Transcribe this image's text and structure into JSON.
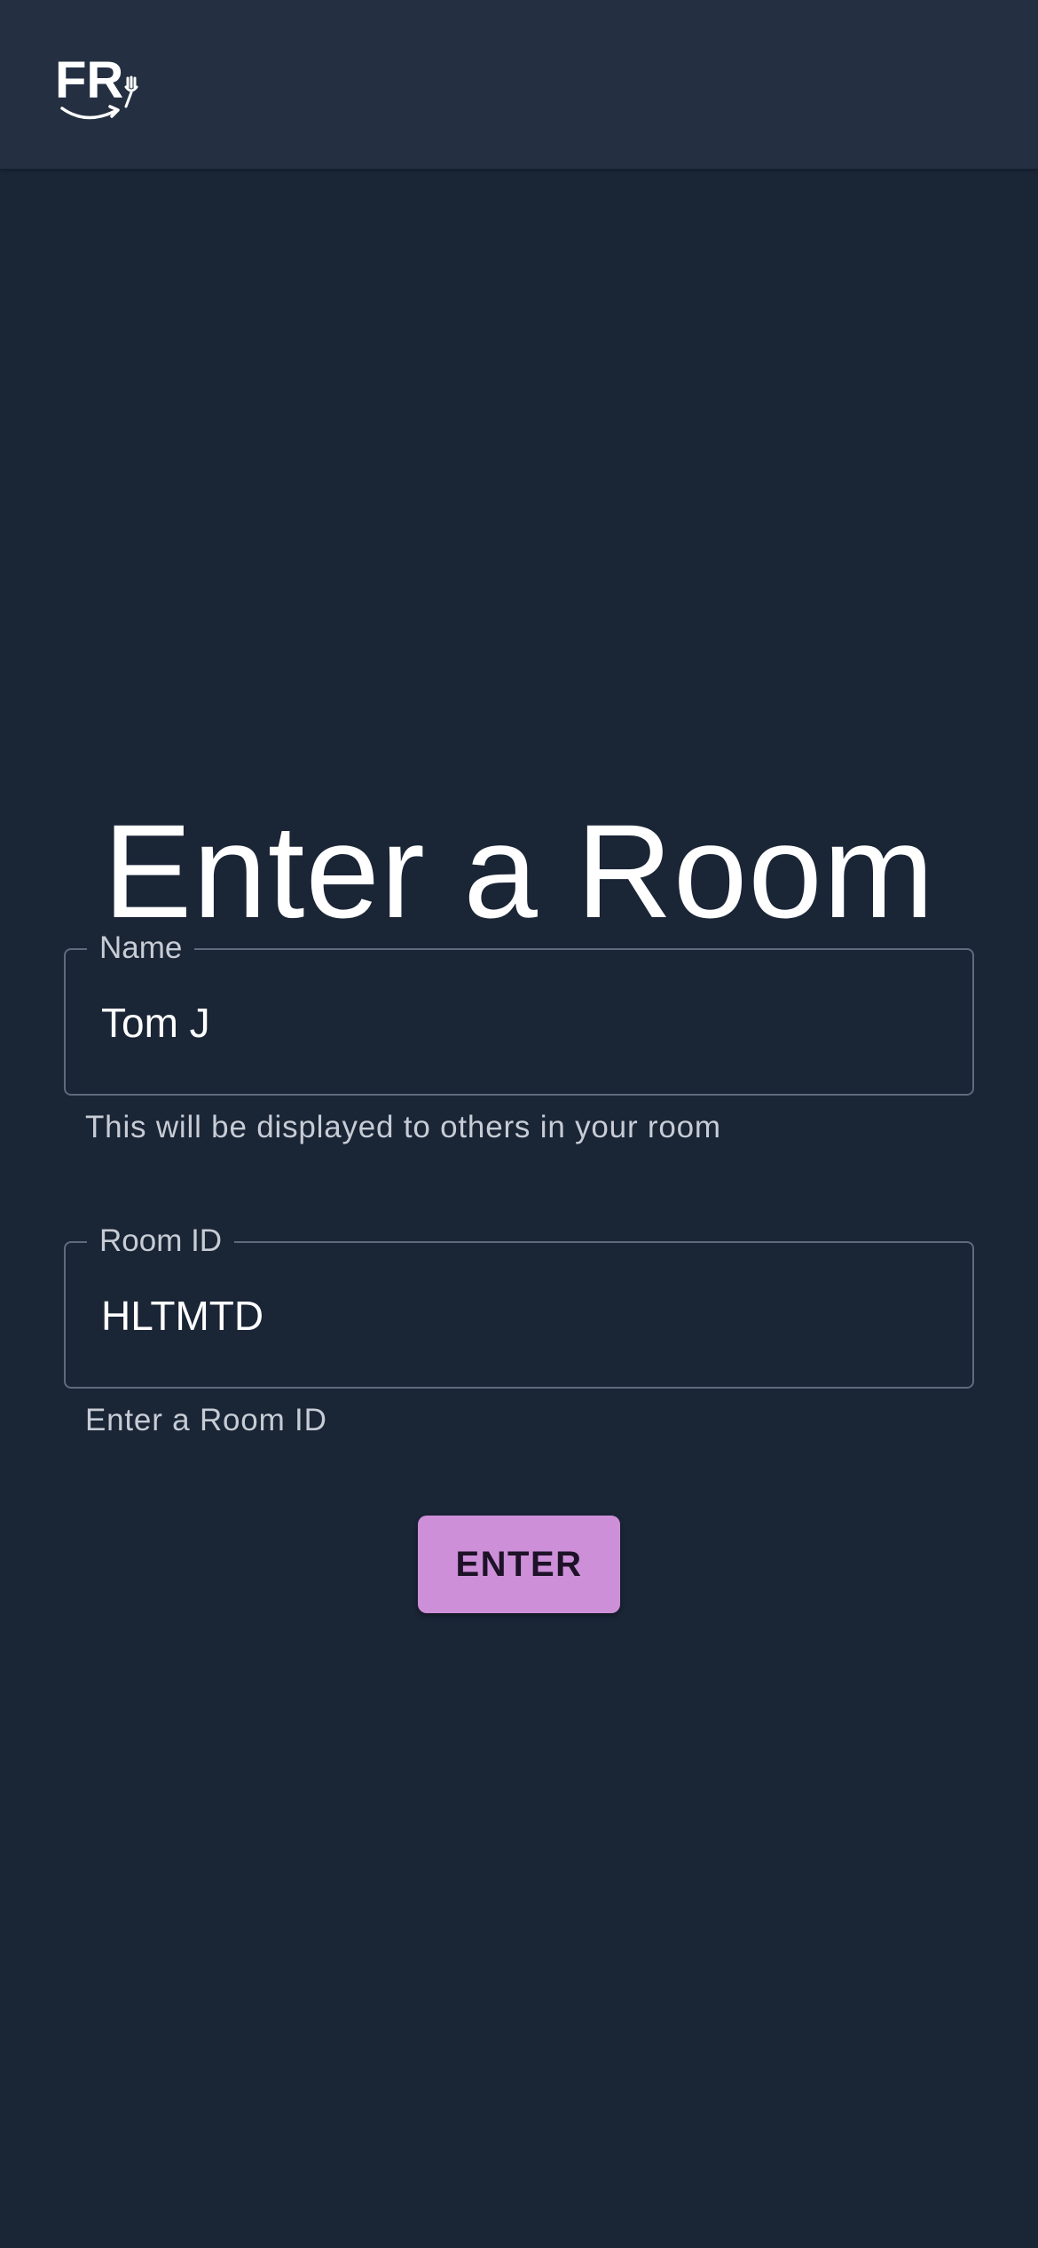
{
  "header": {
    "logo_text": "FR",
    "logo_icon": "fork-smile-logo"
  },
  "main": {
    "title": "Enter a Room"
  },
  "form": {
    "name": {
      "label": "Name",
      "value": "Tom J",
      "helper": "This will be displayed to others in your room"
    },
    "room_id": {
      "label": "Room ID",
      "value": "HLTMTD",
      "helper": "Enter a Room ID"
    },
    "submit_label": "ENTER"
  },
  "colors": {
    "background": "#1a2536",
    "header": "#243042",
    "accent": "#cd90d8",
    "outline": "#5f6b7d"
  }
}
